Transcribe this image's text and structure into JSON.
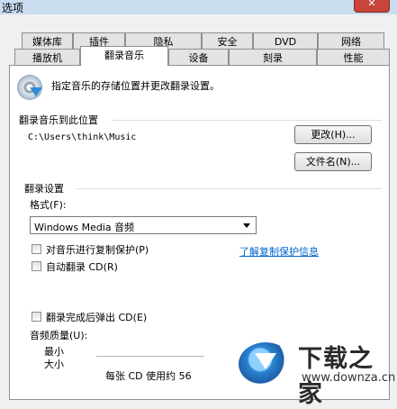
{
  "window": {
    "title": "选项",
    "close_label": "✕"
  },
  "tabs": {
    "row1": [
      "媒体库",
      "插件",
      "隐私",
      "安全",
      "DVD",
      "网络"
    ],
    "row2": [
      "播放机",
      "翻录音乐",
      "设备",
      "刻录",
      "性能"
    ]
  },
  "header": {
    "icon": "cd-rip-icon",
    "text": "指定音乐的存储位置并更改翻录设置。"
  },
  "rip_location": {
    "group_label": "翻录音乐到此位置",
    "path": "C:\\Users\\think\\Music",
    "change_button": "更改(H)...",
    "filename_button": "文件名(N)..."
  },
  "rip_settings": {
    "group_label": "翻录设置",
    "format_label": "格式(F):",
    "format_value": "Windows Media 音频",
    "copy_protect_label": "对音乐进行复制保护(P)",
    "copy_protect_checked": false,
    "auto_rip_label": "自动翻录 CD(R)",
    "auto_rip_checked": false,
    "copy_protect_link": "了解复制保护信息",
    "eject_label": "翻录完成后弹出 CD(E)",
    "eject_checked": false,
    "quality_label": "音频质量(U):",
    "quality_min_line1": "最小",
    "quality_min_line2": "大小",
    "usage_text": "每张 CD 使用约 56"
  },
  "watermark": {
    "cn": "下载之家",
    "en": "www.downza.cn"
  },
  "colors": {
    "accent": "#0066cc",
    "close": "#c7453a"
  }
}
